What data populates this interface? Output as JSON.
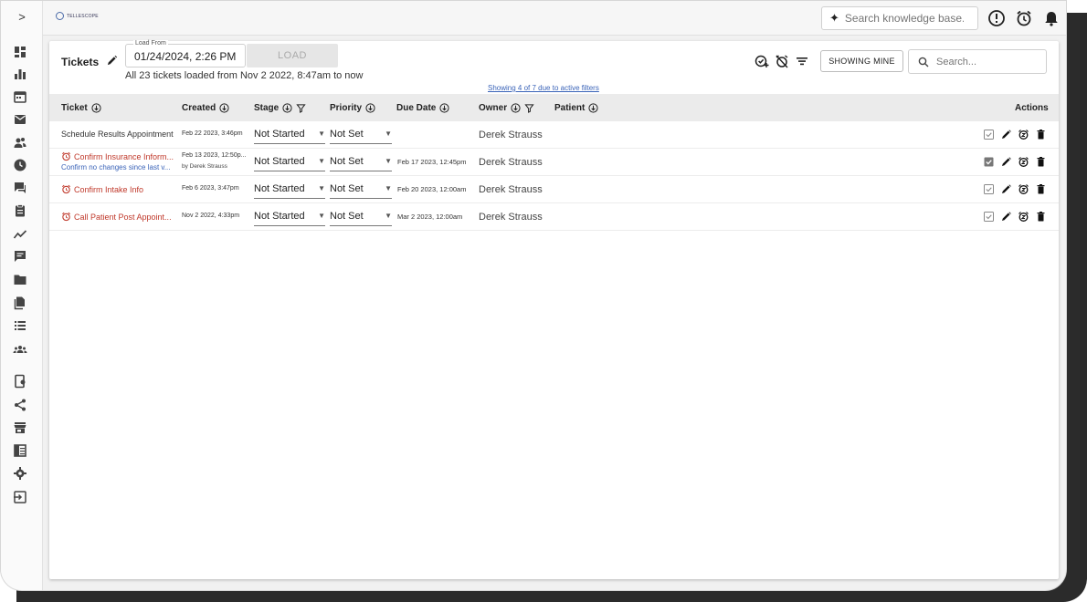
{
  "app": {
    "logo_text": "TELLESCOPE"
  },
  "topbar": {
    "kb_placeholder": "Search knowledge base..."
  },
  "tickets": {
    "title": "Tickets",
    "load_from_label": "Load From",
    "load_from_value": "01/24/2024, 2:26 PM",
    "load_button": "LOAD",
    "loaded_message": "All 23 tickets loaded from Nov 2 2022, 8:47am to now",
    "filter_note": "Showing 4 of 7 due to active filters",
    "showing_mine": "SHOWING MINE",
    "search_placeholder": "Search..."
  },
  "columns": [
    "Ticket",
    "Created",
    "Stage",
    "Priority",
    "Due Date",
    "Owner",
    "Patient",
    "Actions"
  ],
  "rows": [
    {
      "title": "Schedule Results Appointment",
      "overdue": false,
      "subtitle": "",
      "created": "Feb 22 2023, 3:46pm",
      "created_by": "",
      "stage": "Not Started",
      "priority": "Not Set",
      "due": "",
      "owner": "Derek Strauss",
      "patient": "",
      "checked": false
    },
    {
      "title": "Confirm Insurance Inform...",
      "overdue": true,
      "subtitle": "Confirm no changes since last v...",
      "created": "Feb 13 2023, 12:50p...",
      "created_by": "by Derek Strauss",
      "stage": "Not Started",
      "priority": "Not Set",
      "due": "Feb 17 2023, 12:45pm",
      "owner": "Derek Strauss",
      "patient": "",
      "checked": true
    },
    {
      "title": "Confirm Intake Info",
      "overdue": true,
      "subtitle": "",
      "created": "Feb 6 2023, 3:47pm",
      "created_by": "",
      "stage": "Not Started",
      "priority": "Not Set",
      "due": "Feb 20 2023, 12:00am",
      "owner": "Derek Strauss",
      "patient": "",
      "checked": false
    },
    {
      "title": "Call Patient Post Appoint...",
      "overdue": true,
      "subtitle": "",
      "created": "Nov 2 2022, 4:33pm",
      "created_by": "",
      "stage": "Not Started",
      "priority": "Not Set",
      "due": "Mar 2 2023, 12:00am",
      "owner": "Derek Strauss",
      "patient": "",
      "checked": false
    }
  ],
  "sidebar_icons": [
    "dashboard-icon",
    "analytics-icon",
    "calendar-icon",
    "email-icon",
    "contacts-icon",
    "tickets-clock-icon",
    "chat-icon",
    "forms-icon",
    "trend-icon",
    "messages-icon",
    "folder-icon",
    "documents-icon",
    "list-icon",
    "groups-icon",
    "app-icon",
    "share-icon",
    "store-icon",
    "table-icon",
    "settings-icon",
    "logout-icon"
  ],
  "colors": {
    "overdue": "#c0392b",
    "link": "#3a63b8",
    "header_bg": "#ebebeb",
    "window_bg": "#f1f1f1"
  }
}
